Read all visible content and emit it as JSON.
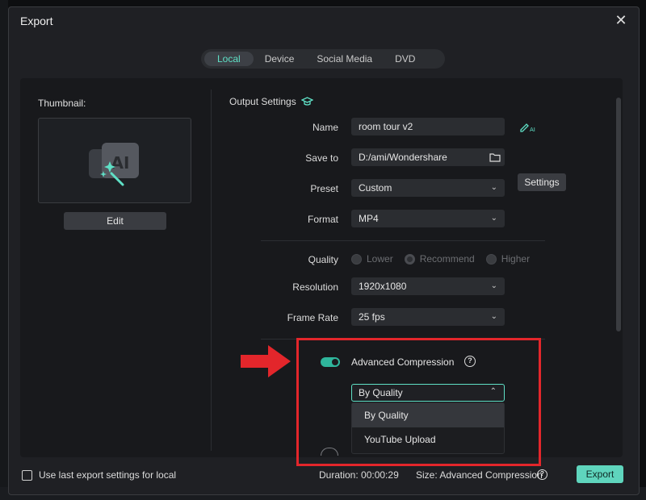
{
  "dialog": {
    "title": "Export",
    "close_icon": "close-icon"
  },
  "tabs": [
    {
      "label": "Local",
      "active": true
    },
    {
      "label": "Device",
      "active": false
    },
    {
      "label": "Social Media",
      "active": false
    },
    {
      "label": "DVD",
      "active": false
    }
  ],
  "thumbnail": {
    "label": "Thumbnail:",
    "edit_label": "Edit",
    "icon": "ai-image-icon",
    "icon_text": "AI"
  },
  "output": {
    "title": "Output Settings",
    "name_label": "Name",
    "name_value": "room tour v2",
    "saveto_label": "Save to",
    "saveto_value": "D:/ami/Wondershare",
    "preset_label": "Preset",
    "preset_value": "Custom",
    "settings_label": "Settings",
    "format_label": "Format",
    "format_value": "MP4",
    "quality_label": "Quality",
    "quality_options": [
      "Lower",
      "Recommend",
      "Higher"
    ],
    "quality_selected": "Recommend",
    "resolution_label": "Resolution",
    "resolution_value": "1920x1080",
    "framerate_label": "Frame Rate",
    "framerate_value": "25 fps",
    "advanced_label": "Advanced Compression",
    "advanced_enabled": true,
    "compression_value": "By Quality",
    "compression_options": [
      "By Quality",
      "YouTube Upload"
    ]
  },
  "footer": {
    "checkbox_label": "Use last export settings for local",
    "duration": "Duration: 00:00:29",
    "size": "Size: Advanced Compression",
    "export_label": "Export"
  },
  "colors": {
    "accent": "#5fe0c6",
    "highlight_box": "#e3262b",
    "export_button": "#5fd5bd"
  }
}
